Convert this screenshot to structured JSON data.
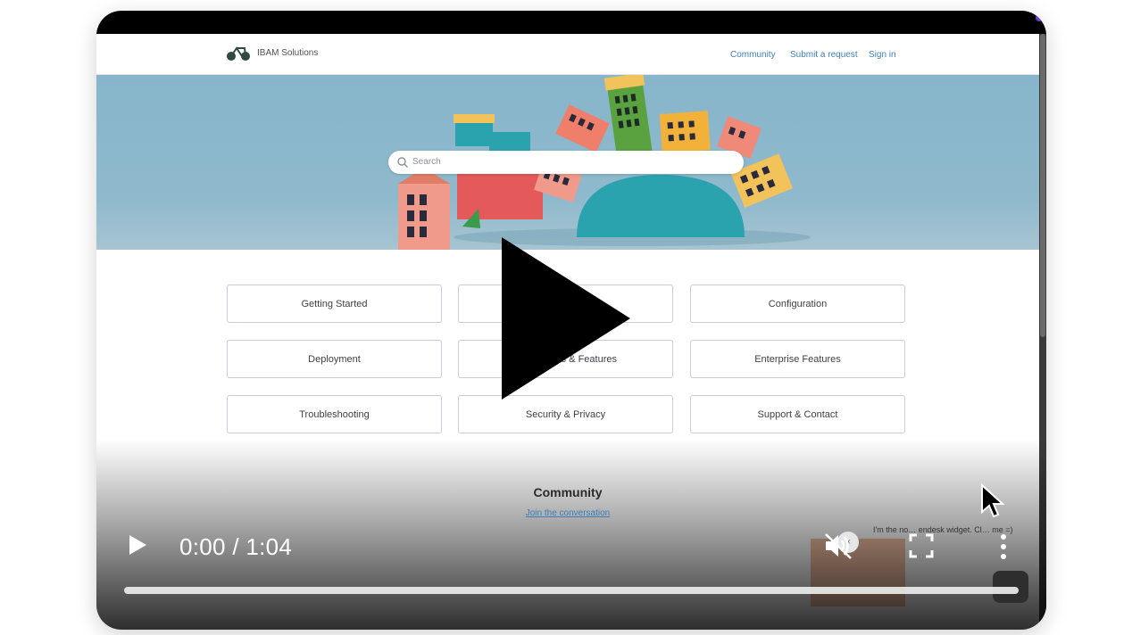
{
  "site": {
    "brand": "IBAM Solutions",
    "nav": [
      "Community",
      "Submit a request",
      "Sign in"
    ],
    "search_placeholder": "Search"
  },
  "categories": [
    "Getting Started",
    "",
    "Configuration",
    "Deployment",
    "s & Features",
    "Enterprise Features",
    "Troubleshooting",
    "Security & Privacy",
    "Support & Contact"
  ],
  "community": {
    "title": "Community",
    "link": "Join the conversation"
  },
  "widget": {
    "text": "I'm the no… endesk widget. Cl… me =)",
    "close": "×"
  },
  "player": {
    "time": "0:00 / 1:04",
    "progress": 0,
    "muted": true
  },
  "colors": {
    "link": "#3d7fb8",
    "hero_sky": "#8fb9cc",
    "player_bg": "#000000"
  }
}
